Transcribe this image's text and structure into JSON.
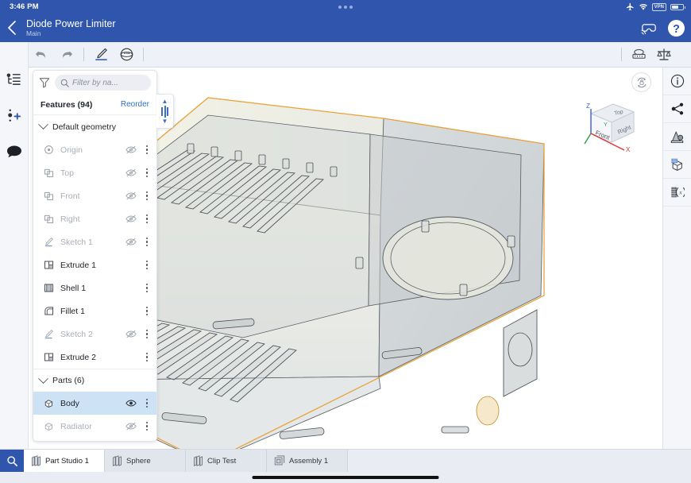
{
  "status_bar": {
    "time": "3:46 PM",
    "vpn_label": "VPN",
    "icons": [
      "airplane-mode-icon",
      "wifi-icon",
      "vpn-badge",
      "battery-icon"
    ]
  },
  "header": {
    "back_label": "Back",
    "document_title": "Diode Power Limiter",
    "workspace": "Main",
    "ar_label": "AR",
    "help_label": "Help",
    "accent_color": "#2f55ac"
  },
  "toolbar": {
    "undo_label": "Undo",
    "redo_label": "Redo",
    "sketch_label": "Sketch",
    "primitive_label": "Primitives",
    "measure_label": "Measure",
    "mass_properties_label": "Mass properties"
  },
  "left_rail": {
    "items": [
      {
        "name": "feature-list",
        "label": "Feature list"
      },
      {
        "name": "versions",
        "label": "Versions and history"
      },
      {
        "name": "comments",
        "label": "Comments"
      }
    ]
  },
  "right_rail": {
    "items": [
      {
        "name": "info",
        "label": "Details"
      },
      {
        "name": "share",
        "label": "Share"
      },
      {
        "name": "appearance",
        "label": "Appearances"
      },
      {
        "name": "display-state",
        "label": "Display states"
      },
      {
        "name": "variables",
        "label": "Variables"
      }
    ]
  },
  "panel": {
    "filter_placeholder": "Filter by na...",
    "features_title": "Features (94)",
    "reorder_label": "Reorder",
    "groups": [
      {
        "label": "Default geometry",
        "expanded": true,
        "items": [
          {
            "label": "Origin",
            "icon": "origin-icon",
            "hidden": true,
            "selected": false,
            "has_eye": true
          },
          {
            "label": "Top",
            "icon": "plane-icon",
            "hidden": true,
            "selected": false,
            "has_eye": true
          },
          {
            "label": "Front",
            "icon": "plane-icon",
            "hidden": true,
            "selected": false,
            "has_eye": true
          },
          {
            "label": "Right",
            "icon": "plane-icon",
            "hidden": true,
            "selected": false,
            "has_eye": true
          },
          {
            "label": "Sketch 1",
            "icon": "sketch-icon",
            "hidden": true,
            "selected": false,
            "has_eye": true
          }
        ]
      }
    ],
    "features": [
      {
        "label": "Extrude 1",
        "icon": "extrude-icon",
        "hidden": false,
        "selected": false,
        "has_eye": false
      },
      {
        "label": "Shell 1",
        "icon": "shell-icon",
        "hidden": false,
        "selected": false,
        "has_eye": false
      },
      {
        "label": "Fillet 1",
        "icon": "fillet-icon",
        "hidden": false,
        "selected": false,
        "has_eye": false
      },
      {
        "label": "Sketch 2",
        "icon": "sketch-icon",
        "hidden": true,
        "selected": false,
        "has_eye": true
      },
      {
        "label": "Extrude 2",
        "icon": "extrude-icon",
        "hidden": false,
        "selected": false,
        "has_eye": false
      }
    ],
    "parts_group": {
      "label": "Parts (6)",
      "expanded": true,
      "items": [
        {
          "label": "Body",
          "icon": "part-icon",
          "hidden": false,
          "selected": true,
          "has_eye": true
        },
        {
          "label": "Radiator",
          "icon": "part-icon",
          "hidden": true,
          "selected": false,
          "has_eye": true
        }
      ]
    },
    "rollback_label": "Rollback bar"
  },
  "viewport": {
    "rotate_label": "Orientation lock",
    "view_cube": {
      "faces": [
        "Top",
        "Front",
        "Right"
      ],
      "axes": [
        {
          "label": "X",
          "color": "#e03131"
        },
        {
          "label": "Y",
          "color": "#2f9e44"
        },
        {
          "label": "Z",
          "color": "#3b5bdb"
        }
      ]
    },
    "model_name": "Body",
    "highlight_color": "#e8a33d"
  },
  "tab_bar": {
    "search_label": "Search tabs",
    "tabs": [
      {
        "label": "Part Studio 1",
        "icon": "part-studio-icon",
        "active": true
      },
      {
        "label": "Sphere",
        "icon": "part-studio-icon",
        "active": false
      },
      {
        "label": "Clip Test",
        "icon": "part-studio-icon",
        "active": false
      },
      {
        "label": "Assembly 1",
        "icon": "assembly-icon",
        "active": false
      }
    ]
  }
}
